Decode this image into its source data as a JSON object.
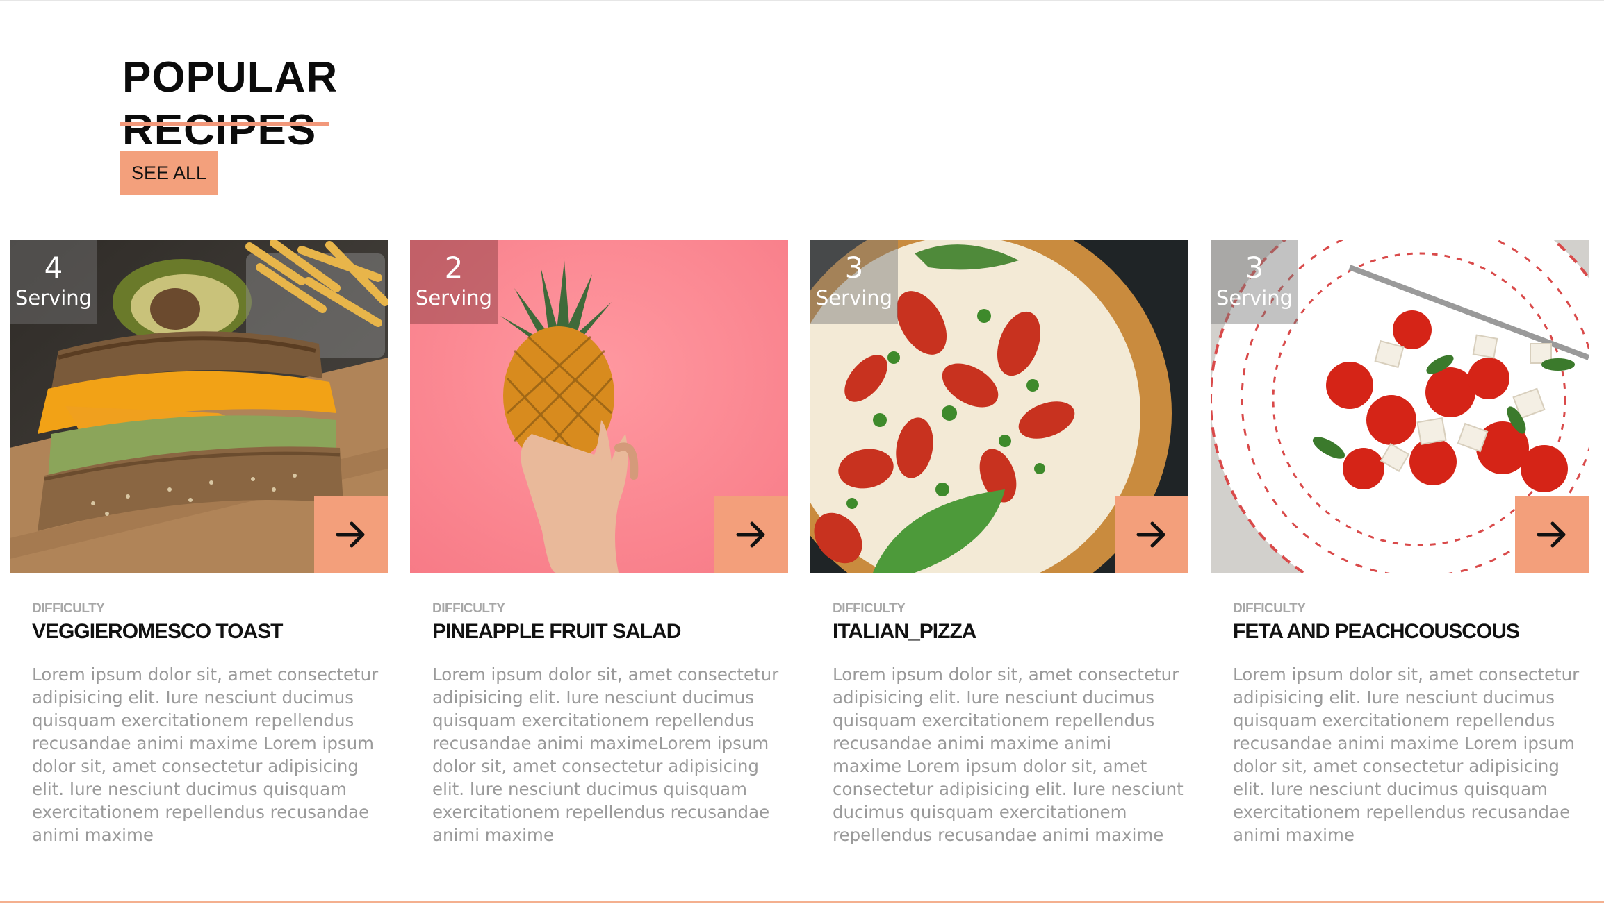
{
  "section": {
    "heading_line1": "POPULAR",
    "heading_line2": "RECIPES",
    "see_all_label": "SEE ALL"
  },
  "colors": {
    "accent": "#f3a07c",
    "heading": "#0b0b0b",
    "muted_text": "#9a9a9a"
  },
  "cards": [
    {
      "serving_count": "4",
      "serving_label": "Serving",
      "difficulty_label": "DIFFICULTY",
      "title": "VEGGIEROMESCO TOAST",
      "description": "Lorem ipsum dolor sit, amet consectetur adipisicing elit. Iure nesciunt ducimus quisquam exercitationem repellendus recusandae animi maxime Lorem ipsum dolor sit, amet consectetur adipisicing elit. Iure nesciunt ducimus quisquam exercitationem repellendus recusandae animi maxime",
      "image_icon": "sandwich-photo",
      "arrow_icon": "arrow-right-icon"
    },
    {
      "serving_count": "2",
      "serving_label": "Serving",
      "difficulty_label": "DIFFICULTY",
      "title": "PINEAPPLE FRUIT SALAD",
      "description": "Lorem ipsum dolor sit, amet consectetur adipisicing elit. Iure nesciunt ducimus quisquam exercitationem repellendus recusandae animi maximeLorem ipsum dolor sit, amet consectetur adipisicing elit. Iure nesciunt ducimus quisquam exercitationem repellendus recusandae animi maxime",
      "image_icon": "pineapple-photo",
      "arrow_icon": "arrow-right-icon"
    },
    {
      "serving_count": "3",
      "serving_label": "Serving",
      "difficulty_label": "DIFFICULTY",
      "title": "ITALIAN_PIZZA",
      "description": "Lorem ipsum dolor sit, amet consectetur adipisicing elit. Iure nesciunt ducimus quisquam exercitationem repellendus recusandae animi maxime animi maxime Lorem ipsum dolor sit, amet consectetur adipisicing elit. Iure nesciunt ducimus quisquam exercitationem repellendus recusandae animi maxime",
      "image_icon": "pizza-photo",
      "arrow_icon": "arrow-right-icon"
    },
    {
      "serving_count": "3",
      "serving_label": "Serving",
      "difficulty_label": "DIFFICULTY",
      "title": "FETA AND PEACHCOUSCOUS",
      "description": "Lorem ipsum dolor sit, amet consectetur adipisicing elit. Iure nesciunt ducimus quisquam exercitationem repellendus recusandae animi maxime Lorem ipsum dolor sit, amet consectetur adipisicing elit. Iure nesciunt ducimus quisquam exercitationem repellendus recusandae animi maxime",
      "image_icon": "salad-photo",
      "arrow_icon": "arrow-right-icon"
    }
  ]
}
